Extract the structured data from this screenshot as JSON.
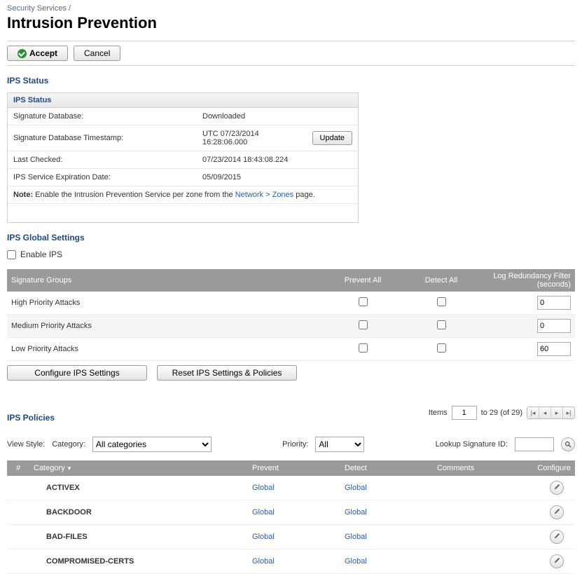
{
  "breadcrumb": "Security Services /",
  "page_title": "Intrusion Prevention",
  "toolbar": {
    "accept_label": "Accept",
    "cancel_label": "Cancel"
  },
  "ips_status": {
    "heading": "IPS Status",
    "panel_title": "IPS Status",
    "rows": {
      "sig_db_label": "Signature Database:",
      "sig_db_value": "Downloaded",
      "sig_ts_label": "Signature Database Timestamp:",
      "sig_ts_value": "UTC 07/23/2014 16:28:06.000",
      "update_label": "Update",
      "last_checked_label": "Last Checked:",
      "last_checked_value": "07/23/2014 18:43:08.224",
      "expire_label": "IPS Service Expiration Date:",
      "expire_value": "05/09/2015"
    },
    "note_prefix": "Note:",
    "note_text": " Enable the Intrusion Prevention Service per zone from the ",
    "note_link": "Network > Zones",
    "note_suffix": " page."
  },
  "global_settings": {
    "heading": "IPS Global Settings",
    "enable_label": "Enable IPS",
    "columns": {
      "sig_groups": "Signature Groups",
      "prevent": "Prevent All",
      "detect": "Detect All",
      "log": "Log Redundancy Filter (seconds)"
    },
    "rows": [
      {
        "name": "High Priority Attacks",
        "log": "0"
      },
      {
        "name": "Medium Priority Attacks",
        "log": "0"
      },
      {
        "name": "Low Priority Attacks",
        "log": "60"
      }
    ],
    "configure_label": "Configure IPS Settings",
    "reset_label": "Reset IPS Settings & Policies"
  },
  "policies": {
    "heading": "IPS Policies",
    "items_label": "Items",
    "items_value": "1",
    "items_range": "to 29 (of 29)",
    "view_style_label": "View Style:",
    "category_label": "Category:",
    "category_value": "All categories",
    "priority_label": "Priority:",
    "priority_value": "All",
    "lookup_label": "Lookup Signature ID:",
    "headers": {
      "num": "#",
      "category": "Category",
      "prevent": "Prevent",
      "detect": "Detect",
      "comments": "Comments",
      "configure": "Configure"
    },
    "link_text": "Global",
    "rows": [
      {
        "name": "ACTIVEX"
      },
      {
        "name": "BACKDOOR"
      },
      {
        "name": "BAD-FILES"
      },
      {
        "name": "COMPROMISED-CERTS"
      }
    ]
  }
}
